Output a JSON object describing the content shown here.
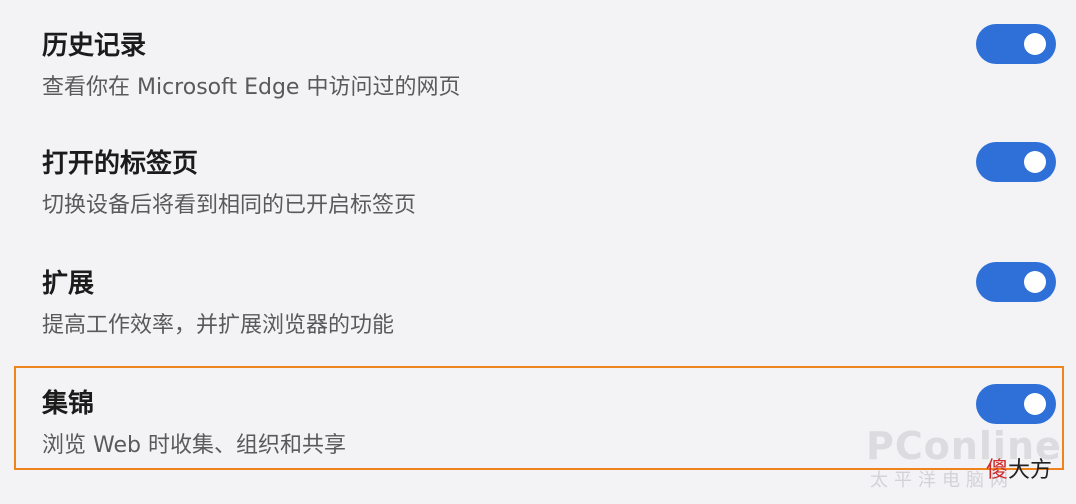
{
  "colors": {
    "background": "#f3f2f5",
    "toggle_on": "#2f6fd8",
    "highlight_border": "#f0841c"
  },
  "settings": [
    {
      "title": "历史记录",
      "desc": "查看你在 Microsoft Edge 中访问过的网页",
      "enabled": true
    },
    {
      "title": "打开的标签页",
      "desc": "切换设备后将看到相同的已开启标签页",
      "enabled": true
    },
    {
      "title": "扩展",
      "desc": "提高工作效率，并扩展浏览器的功能",
      "enabled": true
    },
    {
      "title": "集锦",
      "desc": "浏览 Web 时收集、组织和共享",
      "enabled": true
    }
  ],
  "watermark": {
    "logo": "PConline",
    "sub": "太平洋电脑网",
    "text_first": "傻",
    "text_rest": "大方"
  }
}
